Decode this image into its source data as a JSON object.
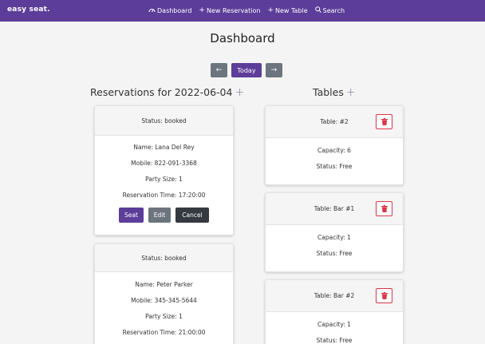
{
  "navbar": {
    "brand": "easy seat.",
    "links": [
      {
        "icon": "dashboard-icon",
        "label": "Dashboard"
      },
      {
        "icon": "plus-icon",
        "label": "New Reservation"
      },
      {
        "icon": "plus-icon",
        "label": "New Table"
      },
      {
        "icon": "search-icon",
        "label": "Search"
      }
    ]
  },
  "page": {
    "title": "Dashboard"
  },
  "date_nav": {
    "prev": "←",
    "today": "Today",
    "next": "→"
  },
  "reservations": {
    "heading": "Reservations for 2022-06-04",
    "add": "+",
    "items": [
      {
        "status": "Status: booked",
        "name": "Name: Lana Del Rey",
        "mobile": "Mobile: 822-091-3368",
        "party": "Party Size: 1",
        "time": "Reservation Time: 17:20:00",
        "actions": {
          "seat": "Seat",
          "edit": "Edit",
          "cancel": "Cancel"
        }
      },
      {
        "status": "Status: booked",
        "name": "Name: Peter Parker",
        "mobile": "Mobile: 345-345-5644",
        "party": "Party Size: 1",
        "time": "Reservation Time: 21:00:00"
      }
    ]
  },
  "tables": {
    "heading": "Tables",
    "add": "+",
    "items": [
      {
        "name": "Table: #2",
        "capacity": "Capacity: 6",
        "status": "Status: Free"
      },
      {
        "name": "Table: Bar #1",
        "capacity": "Capacity: 1",
        "status": "Status: Free"
      },
      {
        "name": "Table: Bar #2",
        "capacity": "Capacity: 1",
        "status": "Status: Free"
      }
    ]
  },
  "colors": {
    "primary": "#5c3d99",
    "secondary": "#6c757d",
    "dark": "#343a40",
    "danger": "#dc3545"
  }
}
